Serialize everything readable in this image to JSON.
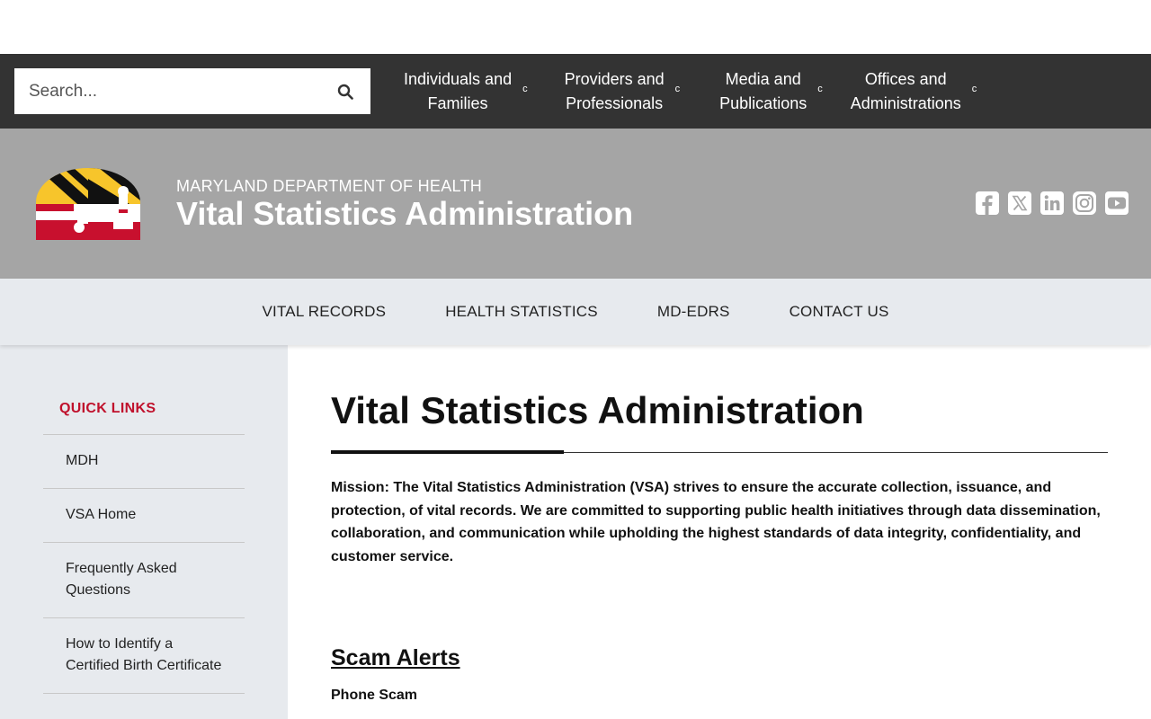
{
  "search": {
    "placeholder": "Search..."
  },
  "main_nav": [
    {
      "line1": "Individuals and",
      "line2": "Families"
    },
    {
      "line1": "Providers and",
      "line2": "Professionals"
    },
    {
      "line1": "Media and",
      "line2": "Publications"
    },
    {
      "line1": "Offices and",
      "line2": "Administrations"
    }
  ],
  "chevron_glyph": "c",
  "banner": {
    "department": "MARYLAND DEPARTMENT OF HEALTH",
    "agency": "Vital Statistics Administration"
  },
  "social_icons": [
    "facebook-icon",
    "x-twitter-icon",
    "linkedin-icon",
    "instagram-icon",
    "youtube-icon"
  ],
  "sub_nav": [
    "VITAL RECORDS",
    "HEALTH STATISTICS",
    "MD-EDRS",
    "CONTACT US"
  ],
  "sidebar": {
    "title": "QUICK LINKS",
    "items": [
      "MDH",
      "VSA Home",
      "Frequently Asked Questions",
      "How to Identify a Certified Birth Certificate"
    ]
  },
  "main": {
    "title": "Vital Statistics Administration",
    "mission": "Mission: The Vital Statistics Administration (VSA) strives to ensure the accurate collection, issuance, and protection, of vital records. We are committed to supporting public health initiatives through data dissemination, collaboration, and communication while upholding the highest standards of data integrity, confidentiality, and customer service.",
    "scam_heading": "Scam Alerts",
    "phone_scam": "Phone Scam"
  },
  "colors": {
    "topbar": "#333333",
    "banner": "#a5a5a5",
    "subnav": "#e7eaee",
    "accent_red": "#c0112c",
    "flag_gold": "#f7c52b",
    "flag_red": "#c8102e"
  }
}
